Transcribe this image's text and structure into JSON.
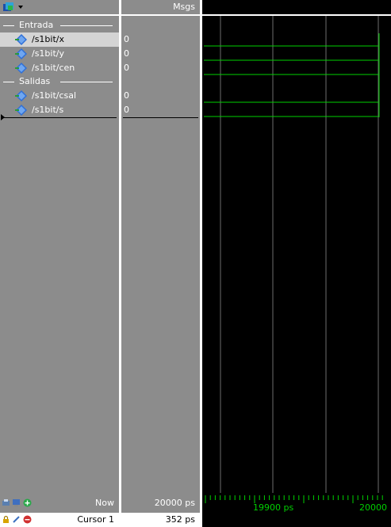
{
  "header": {
    "msgs_label": "Msgs",
    "toolbar_icon": "wave-group-icon",
    "dropdown_icon": "chevron-down-icon"
  },
  "groups": [
    {
      "label": "Entrada",
      "signals": [
        {
          "name": "/s1bit/x",
          "value": "0",
          "selected": true
        },
        {
          "name": "/s1bit/y",
          "value": "0",
          "selected": false
        },
        {
          "name": "/s1bit/cen",
          "value": "0",
          "selected": false
        }
      ]
    },
    {
      "label": "Salidas",
      "signals": [
        {
          "name": "/s1bit/csal",
          "value": "0",
          "selected": false
        },
        {
          "name": "/s1bit/s",
          "value": "0",
          "selected": false
        }
      ]
    }
  ],
  "footer": {
    "now_label": "Now",
    "now_value": "20000 ps",
    "cursor_label": "Cursor 1",
    "cursor_value": "352 ps",
    "timeline": {
      "label_1": "19900 ps",
      "label_2": "20000"
    }
  },
  "colors": {
    "wave": "#00d000",
    "grid": "#6e6e6e",
    "pane_bg": "#8c8c8c",
    "wave_bg": "#000000",
    "selected_row": "#d4d4d4"
  }
}
